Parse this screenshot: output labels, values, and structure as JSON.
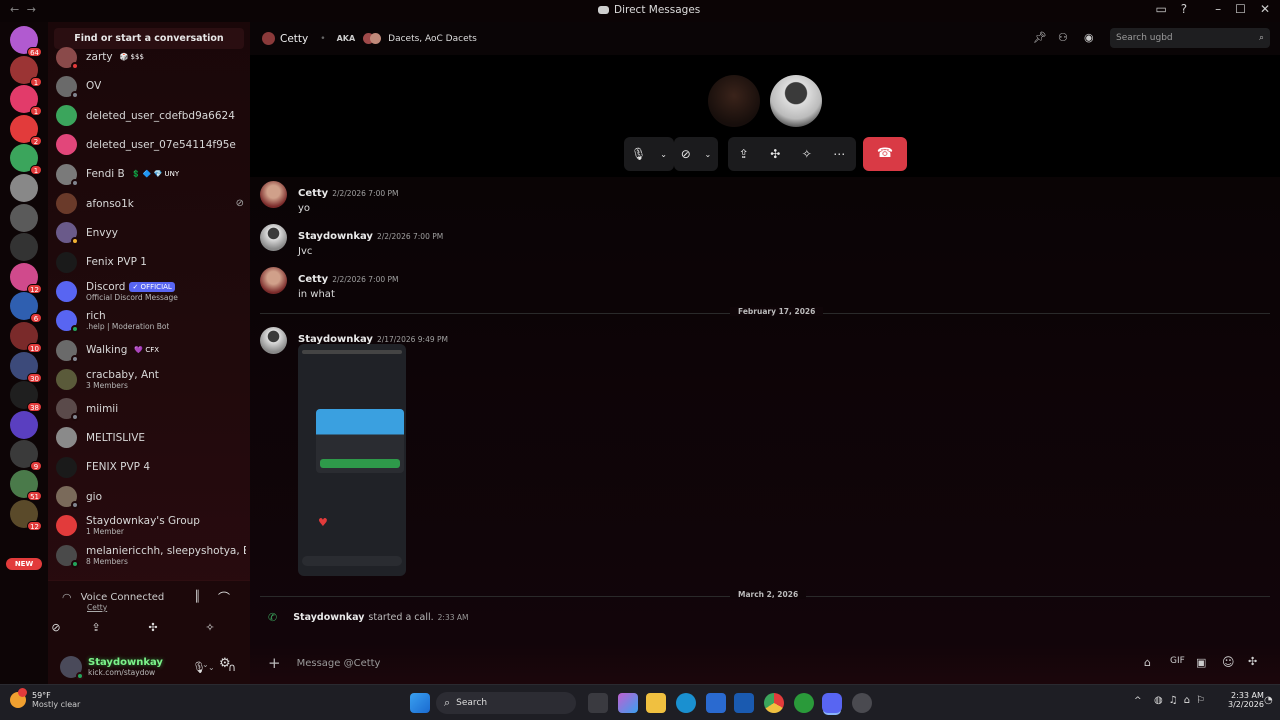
{
  "window": {
    "title": "Direct Messages",
    "back_glyph": "←",
    "forward_glyph": "→"
  },
  "sidebar": {
    "find_label": "Find or start a conversation",
    "new_label": "NEW",
    "servers": [
      {
        "badge": "64",
        "color": "#b15ad0"
      },
      {
        "badge": "1",
        "color": "#9b3434"
      },
      {
        "badge": "1",
        "color": "#e23b6a"
      },
      {
        "badge": "2",
        "color": "#e23b3b"
      },
      {
        "badge": "1",
        "color": "#3ba55c"
      },
      {
        "badge": "",
        "color": "#888888"
      },
      {
        "badge": "",
        "color": "#5a5a5a"
      },
      {
        "badge": "",
        "color": "#333333"
      },
      {
        "badge": "12",
        "color": "#d04a8c"
      },
      {
        "badge": "6",
        "color": "#2f5fb0"
      },
      {
        "badge": "10",
        "color": "#7a2a2a"
      },
      {
        "badge": "30",
        "color": "#3c4a7a"
      },
      {
        "badge": "38",
        "color": "#1f1f1f"
      },
      {
        "badge": "",
        "color": "#5a3fc0"
      },
      {
        "badge": "9",
        "color": "#3a3a3a"
      },
      {
        "badge": "51",
        "color": "#4a7a4a"
      },
      {
        "badge": "12",
        "color": "#5a4a2a"
      }
    ],
    "dms": [
      {
        "name": "zarty",
        "tag": "🎲 $$$",
        "sub": "",
        "color": "#8a4a4a",
        "status": "#e23b3b"
      },
      {
        "name": "OV",
        "tag": "",
        "sub": "",
        "color": "#6a6a6a",
        "status": "#80848e"
      },
      {
        "name": "deleted_user_cdefbd9a6624",
        "tag": "",
        "sub": "",
        "color": "#3ba55c",
        "status": ""
      },
      {
        "name": "deleted_user_07e54114f95e",
        "tag": "",
        "sub": "",
        "color": "#e2467a",
        "status": ""
      },
      {
        "name": "Fendi B",
        "tag": "💲 🔷 💎 UNY",
        "sub": "",
        "color": "#7a7a7a",
        "status": "#80848e"
      },
      {
        "name": "afonso1k",
        "tag": "",
        "sub": "",
        "color": "#6a3a2a",
        "status": ""
      },
      {
        "name": "Envyy",
        "tag": "",
        "sub": "",
        "color": "#6a5a8a",
        "status": "#f0b232"
      },
      {
        "name": "Fenix PVP 1",
        "tag": "",
        "sub": "",
        "color": "#1a1a1a",
        "status": ""
      },
      {
        "name": "Discord",
        "tag": "✓ OFFICIAL",
        "sub": "Official Discord Message",
        "color": "#5865f2",
        "status": ""
      },
      {
        "name": "rich",
        "tag": "",
        "sub": ".help | Moderation Bot",
        "color": "#5865f2",
        "status": "#23a55a"
      },
      {
        "name": "Walking",
        "tag": "💜 CFX",
        "sub": "",
        "color": "#6a6a6a",
        "status": "#80848e"
      },
      {
        "name": "cracbaby, Ant",
        "tag": "",
        "sub": "3 Members",
        "color": "#5a5a3a",
        "status": ""
      },
      {
        "name": "miimii",
        "tag": "",
        "sub": "",
        "color": "#5a4a4a",
        "status": "#80848e"
      },
      {
        "name": "MELTISLIVE",
        "tag": "",
        "sub": "",
        "color": "#8a8a8a",
        "status": ""
      },
      {
        "name": "FENIX PVP 4",
        "tag": "",
        "sub": "",
        "color": "#1a1a1a",
        "status": ""
      },
      {
        "name": "gio",
        "tag": "",
        "sub": "",
        "color": "#7a6a5a",
        "status": "#80848e"
      },
      {
        "name": "Staydownkay's Group",
        "tag": "",
        "sub": "1 Member",
        "color": "#e23b3b",
        "status": ""
      },
      {
        "name": "melaniericchh, sleepyshotya, B...",
        "tag": "",
        "sub": "8 Members",
        "color": "#4a4a4a",
        "status": "#23a55a"
      }
    ],
    "voice": {
      "status": "Voice Connected",
      "channel": "Cetty"
    },
    "user": {
      "name": "Staydownkay",
      "sub": "kick.com/staydow"
    }
  },
  "header": {
    "name": "Cetty",
    "aka": "AKA",
    "aka_names": "Dacets, AoC Dacets",
    "search_placeholder": "Search ugbd"
  },
  "messages": [
    {
      "author": "Cetty",
      "time": "2/2/2026 7:00 PM",
      "text": "yo"
    },
    {
      "author": "Staydownkay",
      "time": "2/2/2026 7:00 PM",
      "text": "Jvc"
    },
    {
      "author": "Cetty",
      "time": "2/2/2026 7:00 PM",
      "text": "in what"
    },
    {
      "author": "Staydownkay",
      "time": "2/17/2026 9:49 PM",
      "text": ""
    }
  ],
  "dividers": {
    "feb17": "February 17, 2026",
    "mar2": "March 2, 2026"
  },
  "call_event": {
    "author": "Staydownkay",
    "text": "started a call.",
    "time": "2:33 AM"
  },
  "composer": {
    "placeholder": "Message @Cetty"
  },
  "taskbar": {
    "weather_temp": "59°F",
    "weather_desc": "Mostly clear",
    "search_label": "Search",
    "time": "2:33 AM",
    "date": "3/2/2026"
  }
}
